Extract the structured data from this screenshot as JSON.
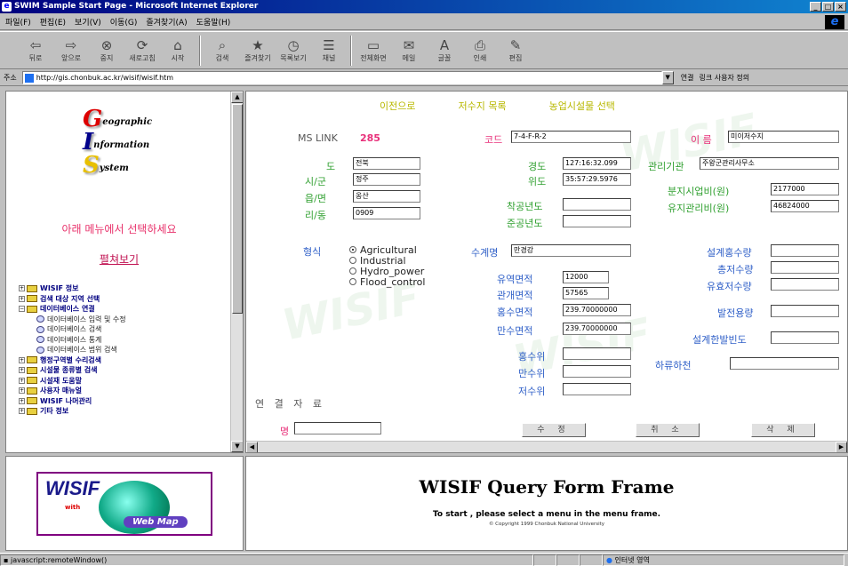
{
  "window": {
    "title": "SWIM Sample Start Page - Microsoft Internet Explorer"
  },
  "menubar": {
    "items": [
      "파일(F)",
      "편집(E)",
      "보기(V)",
      "이동(G)",
      "즐겨찾기(A)",
      "도움말(H)"
    ]
  },
  "toolbar": {
    "items": [
      {
        "label": "뒤로",
        "icon": "back-arrow-icon"
      },
      {
        "label": "앞으로",
        "icon": "forward-arrow-icon"
      },
      {
        "label": "중지",
        "icon": "stop-icon"
      },
      {
        "label": "새로고침",
        "icon": "refresh-icon"
      },
      {
        "label": "시작",
        "icon": "home-icon"
      },
      {
        "label": "검색",
        "icon": "search-icon"
      },
      {
        "label": "즐겨찾기",
        "icon": "favorites-icon"
      },
      {
        "label": "목록보기",
        "icon": "history-icon"
      },
      {
        "label": "채널",
        "icon": "channels-icon"
      },
      {
        "label": "전체화면",
        "icon": "fullscreen-icon"
      },
      {
        "label": "메일",
        "icon": "mail-icon"
      },
      {
        "label": "글꼴",
        "icon": "font-icon"
      },
      {
        "label": "인쇄",
        "icon": "print-icon"
      },
      {
        "label": "편집",
        "icon": "edit-icon"
      }
    ]
  },
  "address": {
    "label": "주소",
    "url": "http://gis.chonbuk.ac.kr/wisif/wisif.htm",
    "go_label": "연결",
    "links_label": "링크 사용자 정의"
  },
  "left_frame": {
    "logo": {
      "letter_g": "G",
      "word_g": "eographic",
      "letter_i": "I",
      "word_i": "nformation",
      "letter_s": "S",
      "word_s": "ystem"
    },
    "select_prompt": "아래 메뉴에서 선택하세요",
    "view_all": "펼쳐보기",
    "tree": [
      {
        "label": "WISIF 정보",
        "level": 0,
        "expanded": false
      },
      {
        "label": "검색 대상 지역 선택",
        "level": 0,
        "expanded": false
      },
      {
        "label": "데이터베이스 연결",
        "level": 0,
        "expanded": true
      },
      {
        "label": "데이터베이스 입력 및 수정",
        "level": 1
      },
      {
        "label": "데이터베이스 검색",
        "level": 1
      },
      {
        "label": "데이터베이스 통계",
        "level": 1
      },
      {
        "label": "데이터베이스 범위 검색",
        "level": 1
      },
      {
        "label": "행정구역별 수리검색",
        "level": 0,
        "expanded": false
      },
      {
        "label": "시설물 종류별 검색",
        "level": 0,
        "expanded": false
      },
      {
        "label": "시설재 도움말",
        "level": 0,
        "expanded": false
      },
      {
        "label": "사용자 매뉴얼",
        "level": 0,
        "expanded": false
      },
      {
        "label": "WISIF 나머관리",
        "level": 0,
        "expanded": false
      },
      {
        "label": "기타 정보",
        "level": 0,
        "expanded": false
      }
    ]
  },
  "form": {
    "nav": [
      "이전으로",
      "저수지 목록",
      "농업시설물 선택"
    ],
    "ms_link_label": "MS LINK",
    "ms_link_value": "285",
    "code_label": "코드",
    "code_value": "7-4-F-R-2",
    "name_label": "이 름",
    "name_value": "미이저수지",
    "do_label": "도",
    "do_value": "전북",
    "sigun_label": "시/군",
    "sigun_value": "정주",
    "eup_label": "읍/면",
    "eup_value": "옹산",
    "ri_label": "리/동",
    "ri_value": "0909",
    "lon_label": "경도",
    "lon_value": "127:16:32.099",
    "lat_label": "위도",
    "lat_value": "35:57:29.5976",
    "agency_label": "관리기관",
    "agency_value": "주왕군관리사무소",
    "cost_label": "분지시업비(원)",
    "cost_value": "2177000",
    "maint_label": "유지관리비(원)",
    "maint_value": "46824000",
    "start_year_label": "착공년도",
    "start_year_value": "",
    "done_year_label": "준공년도",
    "done_year_value": "",
    "type_label": "형식",
    "types": [
      {
        "label": "Agricultural",
        "checked": true
      },
      {
        "label": "Industrial",
        "checked": false
      },
      {
        "label": "Hydro_power",
        "checked": false
      },
      {
        "label": "Flood_control",
        "checked": false
      }
    ],
    "system_label": "수계명",
    "system_value": "만경강",
    "basin_area_label": "유역면적",
    "basin_area_value": "12000",
    "irrig_area_label": "관개면적",
    "irrig_area_value": "57565",
    "flood_area_label": "홍수면적",
    "flood_area_value": "239.70000000",
    "full_area_label": "만수면적",
    "full_area_value": "239.70000000",
    "flood_level_label": "홍수위",
    "flood_level_value": "",
    "full_level_label": "만수위",
    "full_level_value": "",
    "low_level_label": "저수위",
    "low_level_value": "",
    "design_flood_label": "설계홍수량",
    "design_flood_value": "",
    "total_storage_label": "총저수량",
    "total_storage_value": "",
    "eff_storage_label": "유효저수량",
    "eff_storage_value": "",
    "power_label": "발전용량",
    "power_value": "",
    "design_freq_label": "설계한발빈도",
    "design_freq_value": "",
    "river_label": "하류하천",
    "river_value": "",
    "related_label": "연 결 자 료",
    "related_sub": "명",
    "modify_btn": "수 정",
    "cancel_btn": "취 소",
    "delete_btn": "삭 제",
    "watermark": "WISIF"
  },
  "bottom_left": {
    "wisif": "WISIF",
    "with": "with",
    "web_map": "Web Map"
  },
  "bottom_right": {
    "title": "WISIF Query Form Frame",
    "subtitle": "To start , please select a menu in the menu frame.",
    "copyright": "© Copyright 1999 Chonbuk National University"
  },
  "status": {
    "text": "javascript:remoteWindow()",
    "zone": "인터넷 영역"
  }
}
